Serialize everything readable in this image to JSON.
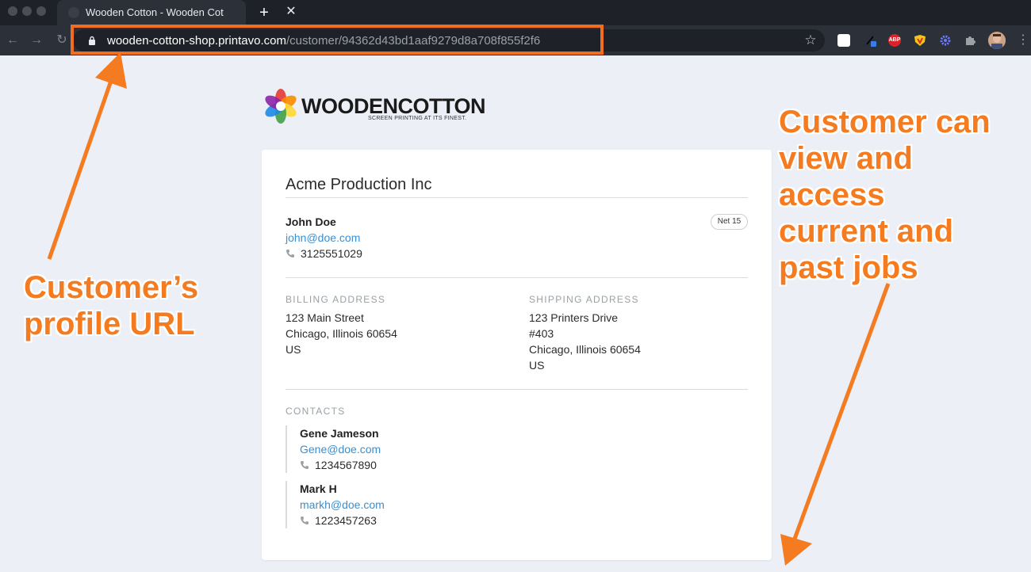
{
  "browser": {
    "tab_title": "Wooden Cotton - Wooden Cotton",
    "tab_close": "✕",
    "new_tab": "+",
    "url_host": "wooden-cotton-shop.printavo.com",
    "url_path": "/customer/94362d43bd1aaf9279d8a708f855f2f6",
    "back_icon": "←",
    "forward_icon": "→",
    "reload_icon": "↻",
    "star_icon": "☆",
    "extensions": [
      "e-icon",
      "pen-icon",
      "adblock-icon",
      "shield-icon",
      "gear-icon",
      "puzzle-icon"
    ],
    "abp_label": "ABP",
    "menu_icon": "⋮"
  },
  "logo": {
    "word": "WOODENCOTTON",
    "tagline": "SCREEN PRINTING AT ITS FINEST."
  },
  "customer": {
    "company": "Acme Production Inc",
    "name": "John Doe",
    "email": "john@doe.com",
    "phone": "3125551029",
    "terms": "Net 15"
  },
  "billing": {
    "label": "BILLING ADDRESS",
    "lines": [
      "123 Main Street",
      "Chicago, Illinois 60654",
      "US"
    ]
  },
  "shipping": {
    "label": "SHIPPING ADDRESS",
    "lines": [
      "123 Printers Drive",
      "#403",
      "Chicago, Illinois 60654",
      "US"
    ]
  },
  "contacts": {
    "label": "CONTACTS",
    "items": [
      {
        "name": "Gene Jameson",
        "email": "Gene@doe.com",
        "phone": "1234567890"
      },
      {
        "name": "Mark H",
        "email": "markh@doe.com",
        "phone": "1223457263"
      }
    ]
  },
  "annotations": {
    "left": [
      "Customer’s",
      "profile URL"
    ],
    "right": [
      "Customer can",
      "view and",
      "access",
      "current and",
      "past jobs"
    ],
    "color": "#f47b20"
  }
}
